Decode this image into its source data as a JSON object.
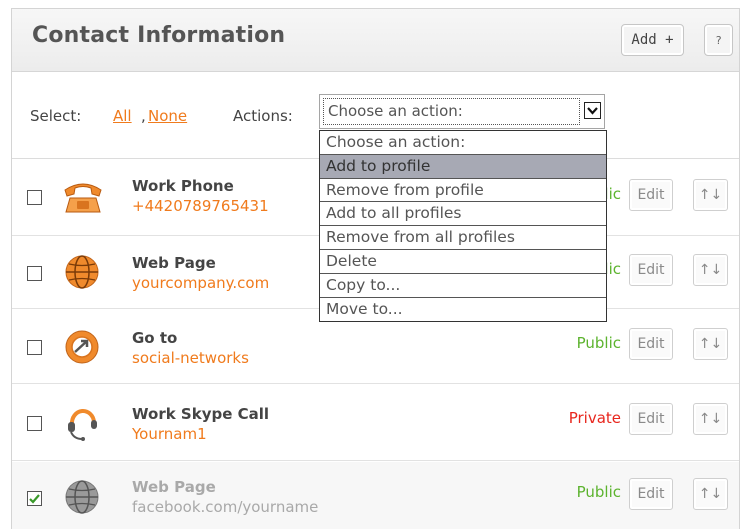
{
  "header": {
    "title": "Contact Information",
    "add_label": "Add +",
    "help_label": "?"
  },
  "selection": {
    "select_label": "Select:",
    "all_label": "All",
    "separator": ",",
    "none_label": "None",
    "actions_label": "Actions:",
    "current_action": "Choose an action:"
  },
  "dropdown": {
    "options": [
      "Choose an action:",
      "Add to profile",
      "Remove from profile",
      "Add to all profiles",
      "Remove from all profiles",
      "Delete",
      "Copy to...",
      "Move to..."
    ],
    "highlighted_index": 1
  },
  "rows": [
    {
      "title": "Work Phone",
      "value": "+4420789765431",
      "status": "Public",
      "icon": "phone-icon",
      "checked": false
    },
    {
      "title": "Web Page",
      "value": "yourcompany.com",
      "status": "Public",
      "icon": "globe-icon",
      "checked": false
    },
    {
      "title": "Go to",
      "value": "social-networks",
      "status": "Public",
      "icon": "arrow-circle-icon",
      "checked": false
    },
    {
      "title": "Work Skype Call",
      "value": "Yournam1",
      "status": "Private",
      "icon": "headset-icon",
      "checked": false
    },
    {
      "title": "Web Page",
      "value": "facebook.com/yourname",
      "status": "Public",
      "icon": "globe-gray-icon",
      "checked": true
    }
  ],
  "buttons": {
    "edit_label": "Edit",
    "sort_label": "↑↓"
  },
  "colors": {
    "link": "#f07b1d",
    "public": "#5cb32e",
    "private": "#e8261d",
    "highlight": "#a7a9b4"
  }
}
